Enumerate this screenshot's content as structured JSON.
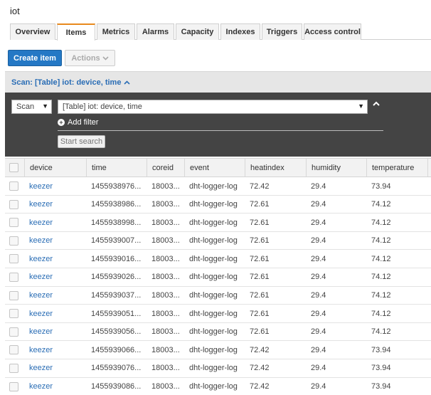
{
  "window": {
    "title": "iot"
  },
  "tabs": [
    {
      "label": "Overview",
      "active": false
    },
    {
      "label": "Items",
      "active": true
    },
    {
      "label": "Metrics",
      "active": false
    },
    {
      "label": "Alarms",
      "active": false
    },
    {
      "label": "Capacity",
      "active": false
    },
    {
      "label": "Indexes",
      "active": false
    },
    {
      "label": "Triggers",
      "active": false
    },
    {
      "label": "Access control",
      "active": false
    }
  ],
  "toolbar": {
    "create_item_label": "Create item",
    "actions_label": "Actions",
    "actions_icon": "chevron-down-icon",
    "primary_color": "#2478c5"
  },
  "scan_bar": {
    "label": "Scan: [Table] iot: device, time",
    "icon": "chevron-up-icon",
    "link_color": "#2a6db5"
  },
  "scan_panel": {
    "mode_select": {
      "value": "Scan"
    },
    "table_select": {
      "value": "[Table] iot: device, time"
    },
    "collapse_icon": "chevron-up-icon",
    "add_filter_label": "Add filter",
    "add_filter_icon": "plus-circle-icon",
    "start_search_label": "Start search",
    "background_color": "#444444"
  },
  "table": {
    "columns": [
      "device",
      "time",
      "coreid",
      "event",
      "heatindex",
      "humidity",
      "temperature"
    ],
    "rows": [
      {
        "device": "keezer",
        "time": "1455938976...",
        "coreid": "18003...",
        "event": "dht-logger-log",
        "heatindex": "72.42",
        "humidity": "29.4",
        "temperature": "73.94"
      },
      {
        "device": "keezer",
        "time": "1455938986...",
        "coreid": "18003...",
        "event": "dht-logger-log",
        "heatindex": "72.61",
        "humidity": "29.4",
        "temperature": "74.12"
      },
      {
        "device": "keezer",
        "time": "1455938998...",
        "coreid": "18003...",
        "event": "dht-logger-log",
        "heatindex": "72.61",
        "humidity": "29.4",
        "temperature": "74.12"
      },
      {
        "device": "keezer",
        "time": "1455939007...",
        "coreid": "18003...",
        "event": "dht-logger-log",
        "heatindex": "72.61",
        "humidity": "29.4",
        "temperature": "74.12"
      },
      {
        "device": "keezer",
        "time": "1455939016...",
        "coreid": "18003...",
        "event": "dht-logger-log",
        "heatindex": "72.61",
        "humidity": "29.4",
        "temperature": "74.12"
      },
      {
        "device": "keezer",
        "time": "1455939026...",
        "coreid": "18003...",
        "event": "dht-logger-log",
        "heatindex": "72.61",
        "humidity": "29.4",
        "temperature": "74.12"
      },
      {
        "device": "keezer",
        "time": "1455939037...",
        "coreid": "18003...",
        "event": "dht-logger-log",
        "heatindex": "72.61",
        "humidity": "29.4",
        "temperature": "74.12"
      },
      {
        "device": "keezer",
        "time": "1455939051...",
        "coreid": "18003...",
        "event": "dht-logger-log",
        "heatindex": "72.61",
        "humidity": "29.4",
        "temperature": "74.12"
      },
      {
        "device": "keezer",
        "time": "1455939056...",
        "coreid": "18003...",
        "event": "dht-logger-log",
        "heatindex": "72.61",
        "humidity": "29.4",
        "temperature": "74.12"
      },
      {
        "device": "keezer",
        "time": "1455939066...",
        "coreid": "18003...",
        "event": "dht-logger-log",
        "heatindex": "72.42",
        "humidity": "29.4",
        "temperature": "73.94"
      },
      {
        "device": "keezer",
        "time": "1455939076...",
        "coreid": "18003...",
        "event": "dht-logger-log",
        "heatindex": "72.42",
        "humidity": "29.4",
        "temperature": "73.94"
      },
      {
        "device": "keezer",
        "time": "1455939086...",
        "coreid": "18003...",
        "event": "dht-logger-log",
        "heatindex": "72.42",
        "humidity": "29.4",
        "temperature": "73.94"
      }
    ]
  }
}
